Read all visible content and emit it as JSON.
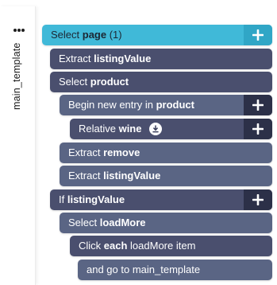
{
  "sidebar": {
    "tab_label": "main_template",
    "menu_icon": "more-dots-icon"
  },
  "rows": [
    {
      "prefix": "Select",
      "keyword": "page",
      "suffix": " (1)",
      "selected": true,
      "has_plus": true
    },
    {
      "prefix": "Extract",
      "keyword": "listingValue",
      "suffix": ""
    },
    {
      "prefix": "Select",
      "keyword": "product",
      "suffix": ""
    },
    {
      "prefix": "Begin new entry in",
      "keyword": "product",
      "suffix": "",
      "has_plus": true
    },
    {
      "prefix": "Relative",
      "keyword": "wine",
      "suffix": "",
      "has_plus": true,
      "badge_icon": "download-icon"
    },
    {
      "prefix": "Extract",
      "keyword": "remove",
      "suffix": ""
    },
    {
      "prefix": "Extract",
      "keyword": "listingValue",
      "suffix": ""
    },
    {
      "prefix": "If",
      "keyword": "listingValue",
      "suffix": "",
      "has_plus": true
    },
    {
      "prefix": "Select",
      "keyword": "loadMore",
      "suffix": ""
    },
    {
      "prefix": "Click",
      "keyword": "each",
      "suffix": " loadMore item"
    },
    {
      "prefix": "and go to main_template",
      "keyword": "",
      "suffix": ""
    }
  ],
  "colors": {
    "selected": "#40b9d8",
    "command": "#4a4f6e",
    "plus_bg": "#2c3048"
  }
}
